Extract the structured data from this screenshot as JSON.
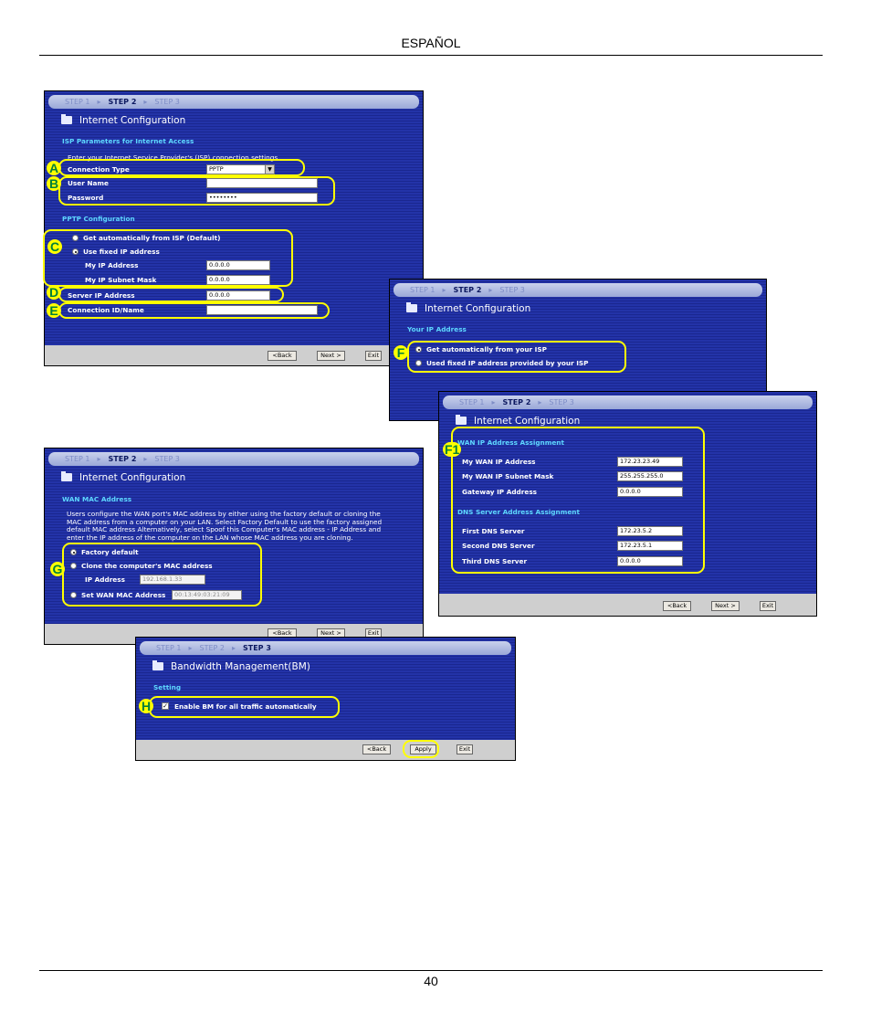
{
  "page": {
    "header": "ESPAÑOL",
    "page_number": "40"
  },
  "step_labels": {
    "s1": "STEP 1",
    "s2": "STEP 2",
    "s3": "STEP 3",
    "sep": "▸"
  },
  "screen1": {
    "title": "Internet Configuration",
    "section_isp": "ISP Parameters for Internet Access",
    "intro": "Enter your Internet Service Provider's (ISP) connection settings",
    "connection_type_label": "Connection Type",
    "connection_type_value": "PPTP",
    "user_name_label": "User Name",
    "user_name_value": "",
    "password_label": "Password",
    "password_value": "••••••••",
    "section_pptp": "PPTP Configuration",
    "radio_auto": "Get automatically from ISP (Default)",
    "radio_fixed": "Use fixed IP address",
    "my_ip_label": "My IP Address",
    "my_ip_value": "0.0.0.0",
    "my_mask_label": "My IP Subnet Mask",
    "my_mask_value": "0.0.0.0",
    "server_ip_label": "Server IP Address",
    "server_ip_value": "0.0.0.0",
    "conn_id_label": "Connection ID/Name",
    "conn_id_value": "",
    "back": "<Back",
    "next": "Next >",
    "exit": "Exit",
    "badges": {
      "a": "A",
      "b": "B",
      "c": "C",
      "d": "D",
      "e": "E"
    }
  },
  "screen2": {
    "title": "Internet Configuration",
    "section": "Your IP Address",
    "radio_auto": "Get automatically from your ISP",
    "radio_fixed": "Used fixed IP address provided by your ISP",
    "badge": "F"
  },
  "screen3": {
    "title": "Internet Configuration",
    "section_wan": "WAN IP Address Assignment",
    "wan_ip_label": "My WAN IP Address",
    "wan_ip_value": "172.23.23.49",
    "wan_mask_label": "My WAN IP Subnet Mask",
    "wan_mask_value": "255.255.255.0",
    "gateway_label": "Gateway IP Address",
    "gateway_value": "0.0.0.0",
    "section_dns": "DNS Server Address Assignment",
    "dns1_label": "First DNS Server",
    "dns1_value": "172.23.5.2",
    "dns2_label": "Second DNS Server",
    "dns2_value": "172.23.5.1",
    "dns3_label": "Third DNS Server",
    "dns3_value": "0.0.0.0",
    "back": "<Back",
    "next": "Next >",
    "exit": "Exit",
    "badge": "F1"
  },
  "screen4": {
    "title": "Internet Configuration",
    "section": "WAN MAC Address",
    "para1": "Users configure the WAN port's MAC address by either using the factory default or cloning the",
    "para2": "MAC address from a computer on your LAN. Select Factory Default to use the factory assigned",
    "para3": "default MAC address Alternatively, select Spoof this Computer's MAC address - IP Address and",
    "para4": "enter the IP address of the computer on the LAN whose MAC address you are cloning.",
    "radio_factory": "Factory default",
    "radio_clone": "Clone the computer's MAC address",
    "ip_label": "IP Address",
    "ip_value": "192.168.1.33",
    "radio_set": "Set WAN MAC Address",
    "mac_value": "00:13:49:03:21:09",
    "back": "<Back",
    "next": "Next >",
    "exit": "Exit",
    "badge": "G"
  },
  "screen5": {
    "title": "Bandwidth Management(BM)",
    "section": "Setting",
    "checkbox_label": "Enable BM for all traffic automatically",
    "back": "<Back",
    "apply": "Apply",
    "exit": "Exit",
    "badge": "H"
  }
}
